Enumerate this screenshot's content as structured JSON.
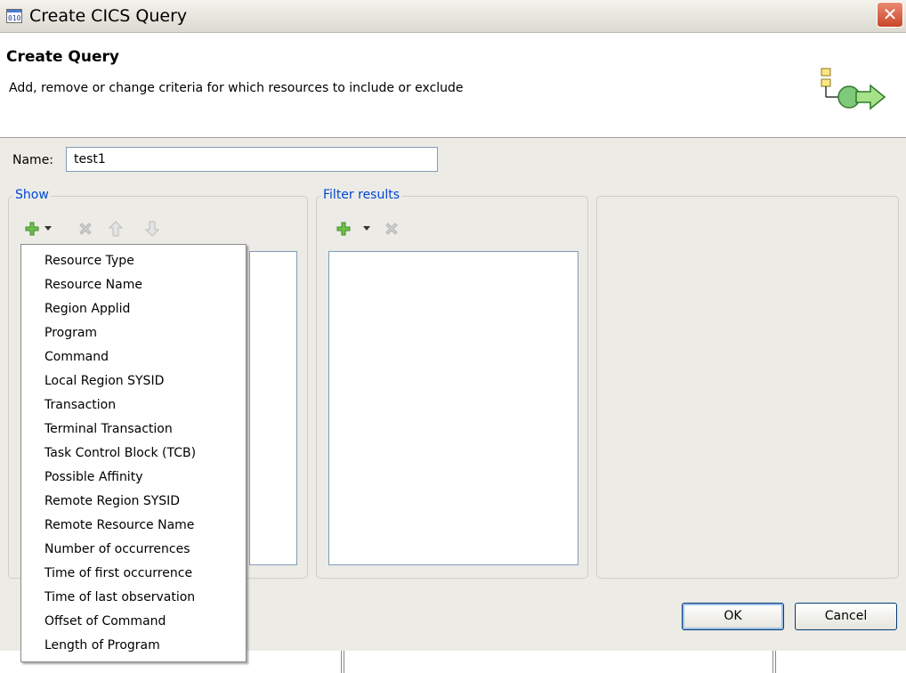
{
  "window": {
    "title": "Create CICS Query"
  },
  "header": {
    "title": "Create Query",
    "description": "Add, remove or change criteria for which resources to include or exclude"
  },
  "name_field": {
    "label": "Name:",
    "value": "test1"
  },
  "show_group": {
    "label": "Show",
    "toolbar_icons": [
      "add-icon",
      "dropdown-arrow-icon",
      "remove-icon",
      "move-up-icon",
      "move-down-icon"
    ]
  },
  "filter_group": {
    "label": "Filter results",
    "toolbar_icons": [
      "add-icon",
      "dropdown-arrow-icon",
      "remove-icon"
    ]
  },
  "dropdown": {
    "items": [
      "Resource Type",
      "Resource Name",
      "Region Applid",
      "Program",
      "Command",
      "Local Region SYSID",
      "Transaction",
      "Terminal Transaction",
      "Task Control Block (TCB)",
      "Possible Affinity",
      "Remote Region SYSID",
      "Remote Resource Name",
      "Number of occurrences",
      "Time of first occurrence",
      "Time of last observation",
      "Offset of Command",
      "Length of Program"
    ]
  },
  "buttons": {
    "ok": "OK",
    "cancel": "Cancel"
  },
  "colors": {
    "group_label": "#0046d5",
    "add_icon": "#6cc04a",
    "disabled_icon": "#c8c8c8",
    "close_button": "#d6563a"
  }
}
